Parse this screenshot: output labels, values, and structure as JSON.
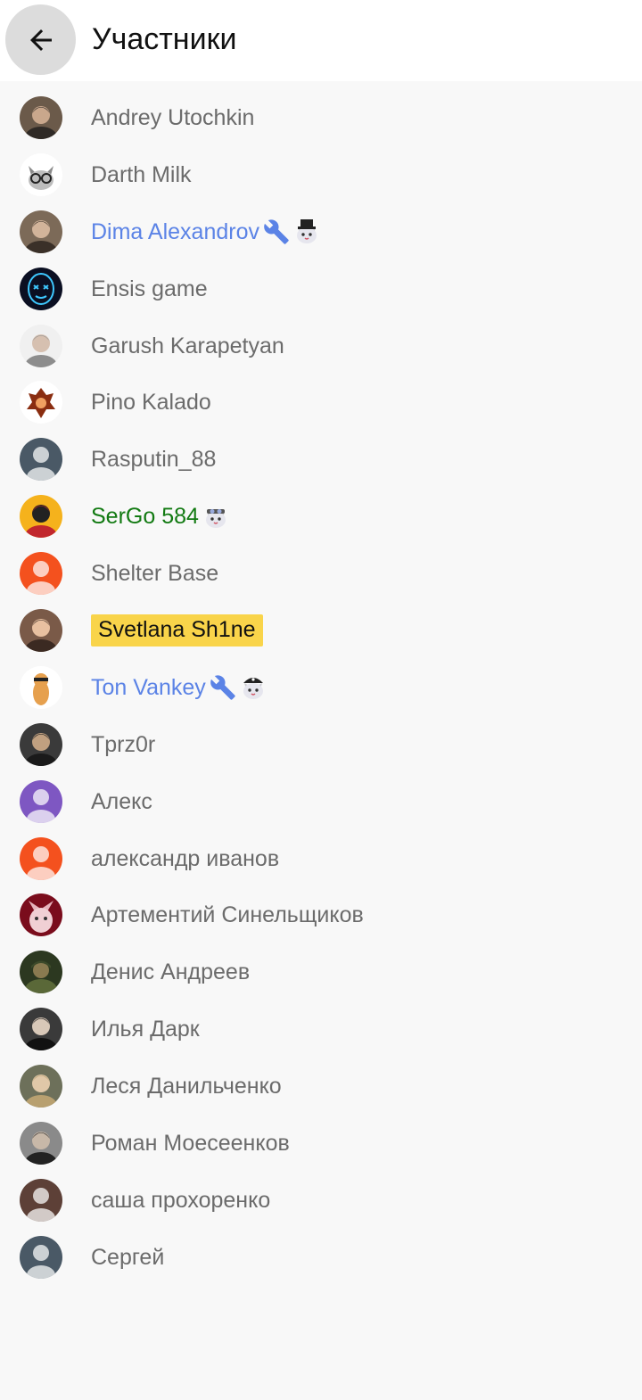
{
  "header": {
    "back_icon": "arrow-left-icon",
    "title": "Участники"
  },
  "colors": {
    "header_bg": "#ffffff",
    "list_bg": "#f8f8f8",
    "moderator_name": "#5b83e6",
    "member_green": "#127a12",
    "highlight_badge": "#f9d44a",
    "default_name": "#6b6b6b"
  },
  "members": [
    {
      "name": "Andrey Utochkin",
      "avatar": "photo"
    },
    {
      "name": "Darth Milk",
      "avatar": "cat-glasses"
    },
    {
      "name": "Dima Alexandrov",
      "avatar": "photo",
      "style": "blue",
      "icons": [
        "wrench-icon",
        "cat-top-hat-icon"
      ]
    },
    {
      "name": "Ensis game",
      "avatar": "neon-mask"
    },
    {
      "name": "Garush Karapetyan",
      "avatar": "photo"
    },
    {
      "name": "Pino Kalado",
      "avatar": "emblem"
    },
    {
      "name": "Rasputin_88",
      "avatar": "default-slate"
    },
    {
      "name": "SerGo 584",
      "avatar": "photo",
      "style": "green",
      "icons": [
        "cat-goggles-icon"
      ]
    },
    {
      "name": "Shelter Base",
      "avatar": "default-orange"
    },
    {
      "name": "Svetlana Sh1ne",
      "avatar": "photo",
      "style": "badge"
    },
    {
      "name": "Ton Vankey",
      "avatar": "cartoon",
      "style": "blue",
      "icons": [
        "wrench-icon",
        "cat-pirate-icon"
      ]
    },
    {
      "name": "Tprz0r",
      "avatar": "photo"
    },
    {
      "name": "Алекс",
      "avatar": "default-purple"
    },
    {
      "name": "александр иванов",
      "avatar": "default-orange"
    },
    {
      "name": "Артементий Синельщиков",
      "avatar": "sphynx-cat"
    },
    {
      "name": "Денис Андреев",
      "avatar": "soldier"
    },
    {
      "name": "Илья Дарк",
      "avatar": "photo"
    },
    {
      "name": "Леся Данильченко",
      "avatar": "photo"
    },
    {
      "name": "Роман Моесеенков",
      "avatar": "photo"
    },
    {
      "name": "саша прохоренко",
      "avatar": "default-brown"
    },
    {
      "name": "Сергей",
      "avatar": "default-slate"
    }
  ]
}
